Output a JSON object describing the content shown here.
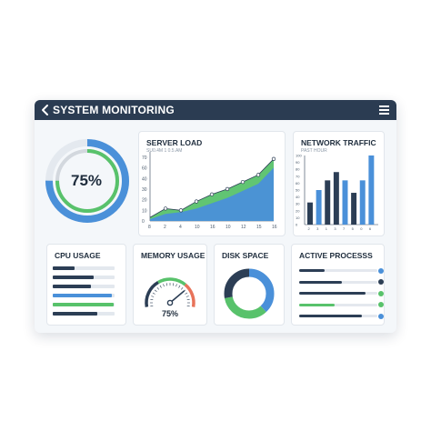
{
  "header": {
    "title": "SYSTEM MONITORING",
    "back_icon": "chevron-left-icon",
    "menu_icon": "hamburger-menu-icon"
  },
  "overall_gauge": {
    "value_text": "75%",
    "percent": 75
  },
  "server_load": {
    "title": "SERVER LOAD",
    "subtitle": "SU0.4M 1 0.5.AM"
  },
  "network_traffic": {
    "title": "NETWORK TRAFFIC",
    "subtitle": "PAST HOUR"
  },
  "cpu_usage": {
    "title": "CPU USAGE",
    "bars": [
      {
        "fraction": 0.36,
        "color": "#2c3e55"
      },
      {
        "fraction": 0.66,
        "color": "#2c3e55"
      },
      {
        "fraction": 0.62,
        "color": "#2c3e55"
      },
      {
        "fraction": 0.96,
        "color": "#4a90d9"
      },
      {
        "fraction": 0.98,
        "color": "#58c26b"
      },
      {
        "fraction": 0.72,
        "color": "#2c3e55"
      }
    ]
  },
  "memory_usage": {
    "title": "MEMORY USAGE",
    "value_text": "75%",
    "percent": 75
  },
  "disk_space": {
    "title": "DISK SPACE",
    "segments": [
      {
        "fraction": 0.38,
        "color": "#4a90d9"
      },
      {
        "fraction": 0.34,
        "color": "#58c26b"
      },
      {
        "fraction": 0.28,
        "color": "#2c3e55"
      }
    ]
  },
  "active_processes": {
    "title": "ACTIVE PROCESSS",
    "rows": [
      {
        "fraction": 0.32,
        "color": "#2c3e55",
        "dot": "#4a90d9"
      },
      {
        "fraction": 0.55,
        "color": "#2c3e55",
        "dot": "#2c3e55"
      },
      {
        "fraction": 0.85,
        "color": "#2c3e55",
        "dot": "#58c26b"
      },
      {
        "fraction": 0.45,
        "color": "#58c26b",
        "dot": "#58c26b"
      },
      {
        "fraction": 0.8,
        "color": "#2c3e55",
        "dot": "#4a90d9"
      }
    ]
  },
  "chart_data": [
    {
      "type": "area",
      "title": "SERVER LOAD",
      "subtitle": "SU0.4M 1 0.5.AM",
      "x": [
        0,
        2,
        4,
        6,
        8,
        10,
        12,
        14,
        16
      ],
      "x_tick_labels": [
        "8",
        "2",
        "4",
        "10",
        "16",
        "10",
        "12",
        "15",
        "16"
      ],
      "y_tick_labels": [
        "70",
        "60",
        "40",
        "30",
        "20",
        "10",
        "0"
      ],
      "ylim": [
        0,
        78
      ],
      "series": [
        {
          "values": [
            4,
            14,
            12,
            22,
            30,
            36,
            44,
            52,
            70
          ],
          "color": "#58c26b"
        },
        {
          "values": [
            2,
            8,
            10,
            14,
            20,
            26,
            34,
            42,
            60
          ],
          "color": "#4a90d9"
        }
      ],
      "grid": false
    },
    {
      "type": "bar",
      "title": "NETWORK TRAFFIC",
      "subtitle": "PAST HOUR",
      "categories": [
        "2",
        "3",
        "1",
        "3",
        "7",
        "5",
        "0",
        "6"
      ],
      "y_tick_labels": [
        "100",
        "90",
        "80",
        "70",
        "60",
        "50",
        "40",
        "30",
        "20",
        "10",
        "0"
      ],
      "ylim": [
        0,
        100
      ],
      "values": [
        32,
        50,
        64,
        76,
        64,
        46,
        64,
        100
      ],
      "colors": [
        "#2c3e55",
        "#4a90d9",
        "#2c3e55",
        "#2c3e55",
        "#4a90d9",
        "#2c3e55",
        "#4a90d9",
        "#4a90d9"
      ],
      "grid": false
    }
  ]
}
